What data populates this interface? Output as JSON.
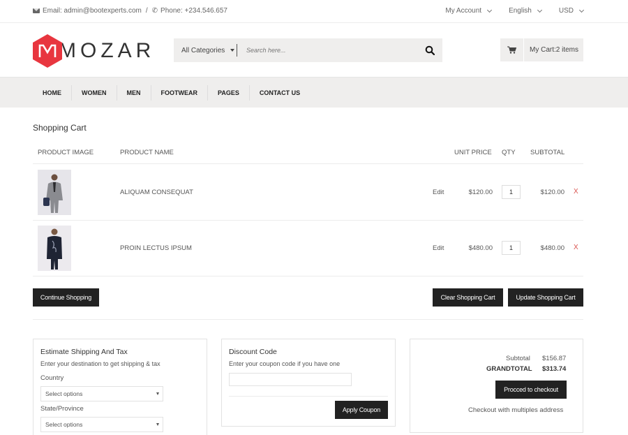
{
  "topbar": {
    "email": "Email: admin@bootexperts.com",
    "separator": "/",
    "phone": "Phone: +234.546.657",
    "account": "My Account",
    "language": "English",
    "currency": "USD"
  },
  "header": {
    "brand": "MOZAR",
    "search_category": "All Categories",
    "search_placeholder": "Search here...",
    "cart_label": "My Cart:2 items"
  },
  "nav": {
    "items": [
      "HOME",
      "WOMEN",
      "MEN",
      "FOOTWEAR",
      "PAGES",
      "CONTACT US"
    ]
  },
  "cart": {
    "title": "Shopping Cart",
    "columns": {
      "image": "PRODUCT IMAGE",
      "name": "PRODUCT NAME",
      "unit_price": "UNIT PRICE",
      "qty": "QTY",
      "subtotal": "SUBTOTAL"
    },
    "rows": [
      {
        "name": "ALIQUAM CONSEQUAT",
        "edit": "Edit",
        "price": "$120.00",
        "qty": "1",
        "subtotal": "$120.00",
        "remove": "X"
      },
      {
        "name": "PROIN LECTUS IPSUM",
        "edit": "Edit",
        "price": "$480.00",
        "qty": "1",
        "subtotal": "$480.00",
        "remove": "X"
      }
    ],
    "continue_label": "Continue Shopping",
    "clear_label": "Clear Shopping Cart",
    "update_label": "Update Shopping Cart"
  },
  "shipping": {
    "title": "Estimate Shipping And Tax",
    "desc": "Enter your destination to get shipping & tax",
    "country_label": "Country",
    "country_value": "Select options",
    "state_label": "State/Province",
    "state_value": "Select options"
  },
  "discount": {
    "title": "Discount Code",
    "desc": "Enter your coupon code if you have one",
    "apply_label": "Apply Coupon"
  },
  "totals": {
    "subtotal_label": "Subtotal",
    "subtotal_value": "$156.87",
    "grandtotal_label": "GRANDTOTAL",
    "grandtotal_value": "$313.74",
    "checkout_label": "Procced to checkout",
    "multi_label": "Checkout with multiples address"
  },
  "colors": {
    "brand_red": "#e8363f",
    "dark_button": "#222222",
    "remove_red": "#d9534f",
    "bar_bg": "#efeeed"
  }
}
